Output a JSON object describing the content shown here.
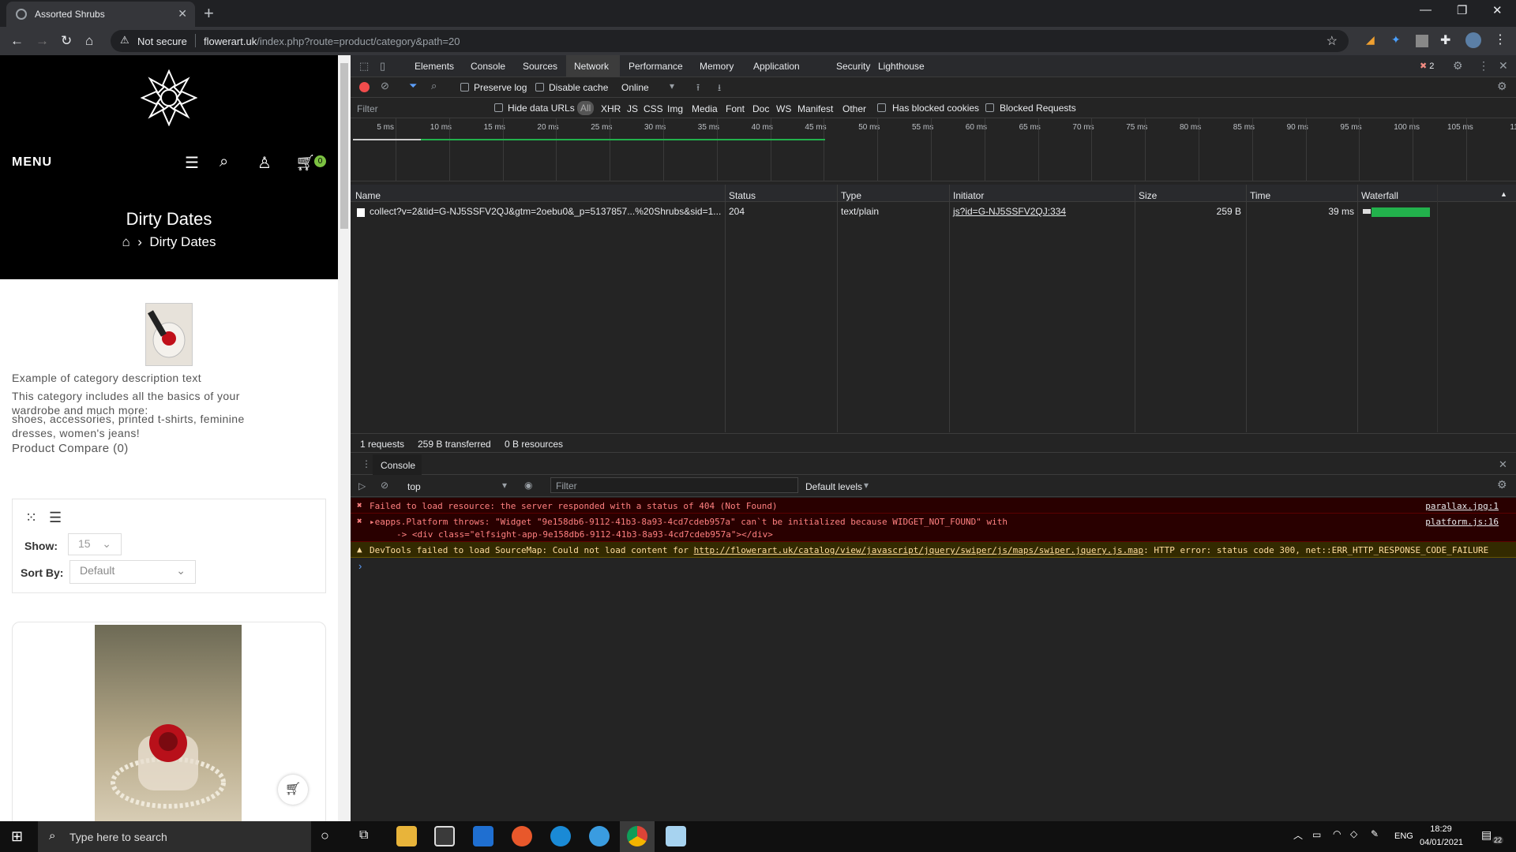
{
  "browser": {
    "tab_title": "Assorted Shrubs",
    "not_secure": "Not secure",
    "url_host": "flowerart.uk",
    "url_path": "/index.php?route=product/category&path=20"
  },
  "site": {
    "menu": "MENU",
    "cart_count": "0",
    "page_title": "Dirty Dates",
    "breadcrumb": "Dirty Dates",
    "desc1": "Example of category description text",
    "desc2": "This category includes all the basics of your wardrobe and much more:",
    "desc3": "shoes, accessories, printed t-shirts, feminine dresses, women's jeans!",
    "compare": "Product Compare (0)",
    "show_label": "Show:",
    "show_value": "15",
    "sort_label": "Sort By:",
    "sort_value": "Default"
  },
  "devtools": {
    "tabs": [
      "Elements",
      "Console",
      "Sources",
      "Network",
      "Performance",
      "Memory",
      "Application",
      "Security",
      "Lighthouse"
    ],
    "error_count": "2",
    "toolbar": {
      "preserve_log": "Preserve log",
      "disable_cache": "Disable cache",
      "throttle": "Online"
    },
    "filter": {
      "placeholder": "Filter",
      "hide_data": "Hide data URLs",
      "all": "All",
      "types": [
        "XHR",
        "JS",
        "CSS",
        "Img",
        "Media",
        "Font",
        "Doc",
        "WS",
        "Manifest",
        "Other"
      ],
      "blocked_cookies": "Has blocked cookies",
      "blocked_requests": "Blocked Requests"
    },
    "ticks": [
      "5 ms",
      "10 ms",
      "15 ms",
      "20 ms",
      "25 ms",
      "30 ms",
      "35 ms",
      "40 ms",
      "45 ms",
      "50 ms",
      "55 ms",
      "60 ms",
      "65 ms",
      "70 ms",
      "75 ms",
      "80 ms",
      "85 ms",
      "90 ms",
      "95 ms",
      "100 ms",
      "105 ms",
      "11"
    ],
    "columns": [
      "Name",
      "Status",
      "Type",
      "Initiator",
      "Size",
      "Time",
      "Waterfall"
    ],
    "request": {
      "name": "collect?v=2&tid=G-NJ5SSFV2QJ&gtm=2oebu0&_p=5137857...%20Shrubs&sid=1...",
      "status": "204",
      "type": "text/plain",
      "initiator": "js?id=G-NJ5SSFV2QJ:334",
      "size": "259 B",
      "time": "39 ms"
    },
    "summary": {
      "requests": "1 requests",
      "transferred": "259 B transferred",
      "resources": "0 B resources"
    },
    "console": {
      "tab": "Console",
      "context": "top",
      "filter_placeholder": "Filter",
      "levels": "Default levels",
      "msg1": "Failed to load resource: the server responded with a status of 404 (Not Found)",
      "src1": "parallax.jpg:1",
      "msg2a": "eapps.Platform throws: \"Widget \"9e158db6-9112-41b3-8a93-4cd7cdeb957a\" can`t be initialized because WIDGET_NOT_FOUND\" with",
      "msg2b": "->   <div class=\"elfsight-app-9e158db6-9112-41b3-8a93-4cd7cdeb957a\"></div>",
      "src2": "platform.js:16",
      "msg3a": "DevTools failed to load SourceMap: Could not load content for ",
      "msg3link": "http://flowerart.uk/catalog/view/javascript/jquery/swiper/js/maps/swiper.jquery.js.map",
      "msg3b": ": HTTP error: status code 300, net::ERR_HTTP_RESPONSE_CODE_FAILURE"
    }
  },
  "taskbar": {
    "search_placeholder": "Type here to search",
    "lang": "ENG",
    "time": "18:29",
    "date": "04/01/2021",
    "notif": "22"
  }
}
